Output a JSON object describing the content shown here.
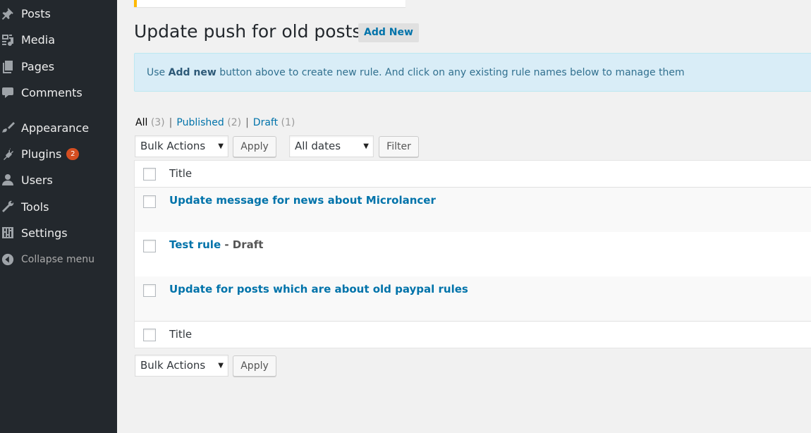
{
  "sidebar": {
    "items": [
      {
        "label": "Posts",
        "icon": "pushpin-icon"
      },
      {
        "label": "Media",
        "icon": "media-icon"
      },
      {
        "label": "Pages",
        "icon": "pages-icon"
      },
      {
        "label": "Comments",
        "icon": "comment-icon"
      },
      {
        "label": "Appearance",
        "icon": "paintbrush-icon"
      },
      {
        "label": "Plugins",
        "icon": "plugin-icon",
        "badge": "2"
      },
      {
        "label": "Users",
        "icon": "user-icon"
      },
      {
        "label": "Tools",
        "icon": "wrench-icon"
      },
      {
        "label": "Settings",
        "icon": "settings-icon"
      }
    ],
    "collapse_label": "Collapse menu"
  },
  "page": {
    "title": "Update push for old posts",
    "add_new": "Add New"
  },
  "info": {
    "prefix": "Use ",
    "strong": "Add new",
    "suffix": " button above to create new rule. And click on any existing rule names below to manage them"
  },
  "filters": {
    "all": {
      "label": "All",
      "count": "(3)"
    },
    "published": {
      "label": "Published",
      "count": "(2)"
    },
    "draft": {
      "label": "Draft",
      "count": "(1)"
    },
    "separator": "|"
  },
  "controls": {
    "bulk_actions": "Bulk Actions",
    "apply": "Apply",
    "all_dates": "All dates",
    "filter": "Filter",
    "caret": "▼"
  },
  "table": {
    "column_title": "Title",
    "rows": [
      {
        "title": "Update message for news about Microlancer",
        "state": ""
      },
      {
        "title": "Test rule",
        "state": " - Draft"
      },
      {
        "title": "Update for posts which are about old paypal rules",
        "state": ""
      }
    ]
  },
  "colors": {
    "sidebar_bg": "#23282d",
    "link": "#0073aa",
    "badge": "#d54e21",
    "notice_accent": "#ffb900",
    "info_bg": "#d9edf7"
  }
}
